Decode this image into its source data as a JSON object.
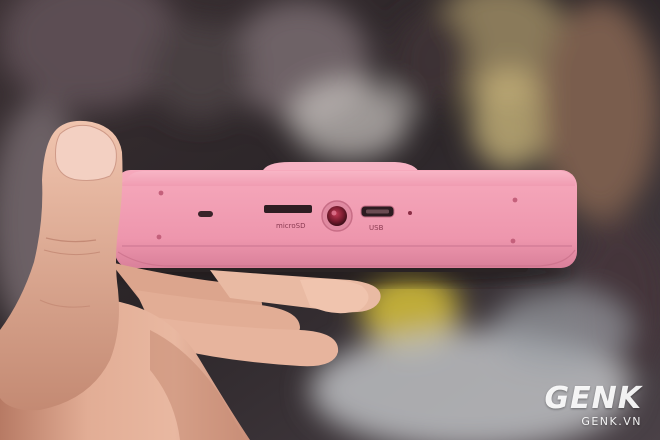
{
  "scene": {
    "description_colors": {
      "device_pink": "#f2a0b4",
      "device_shadow": "#d77d96",
      "skin": "#e8b49c",
      "skin_shadow": "#b97c68"
    }
  },
  "device": {
    "port_labels": {
      "microsd": "microSD",
      "usb": "USB"
    }
  },
  "watermark": {
    "logo": "GENK",
    "site": "GENK.VN"
  }
}
